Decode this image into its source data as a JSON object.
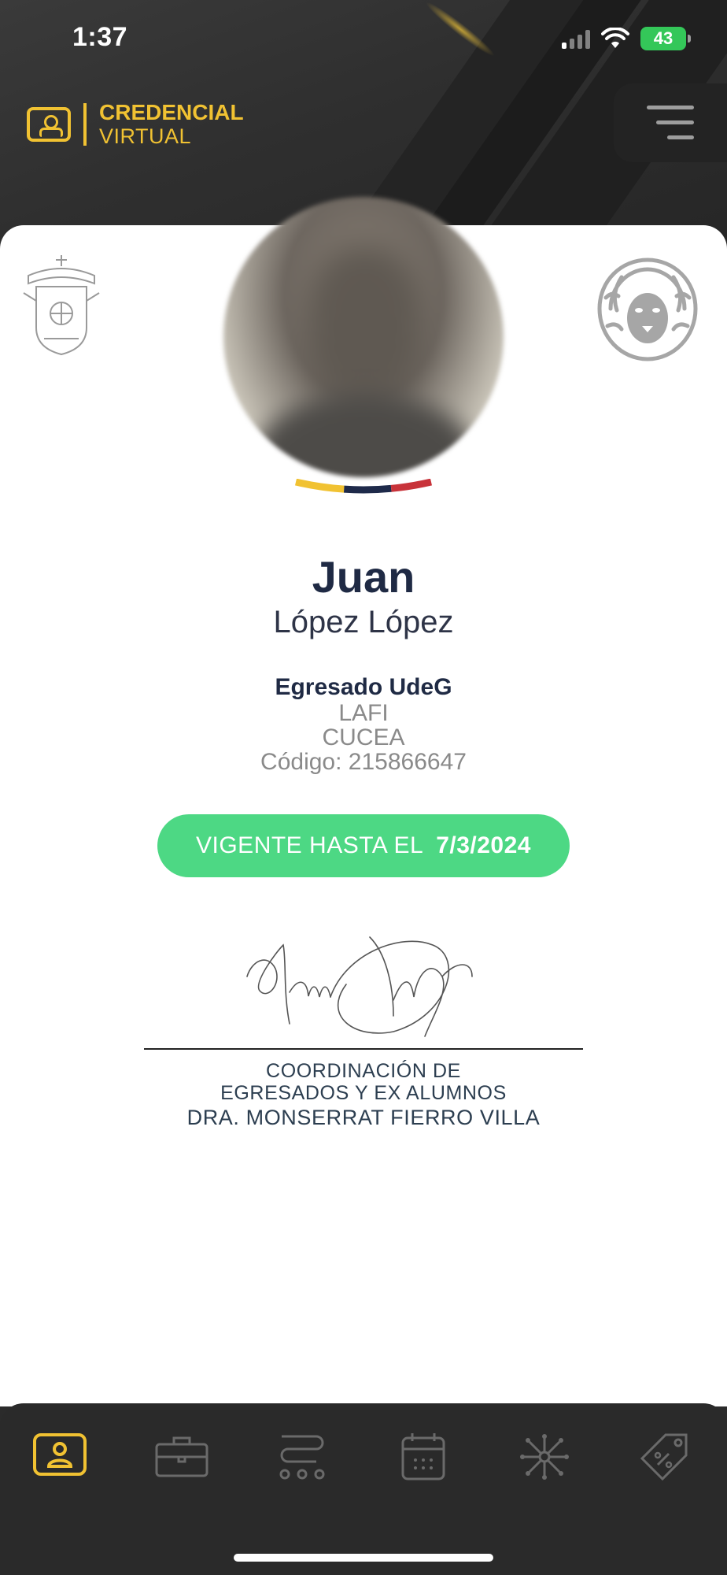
{
  "status_bar": {
    "time": "1:37",
    "battery": "43"
  },
  "brand": {
    "line1": "CREDENCIAL",
    "line2": "VIRTUAL",
    "accent_color": "#f1c232"
  },
  "card": {
    "first_name": "Juan",
    "last_name": "López López",
    "role": "Egresado UdeG",
    "program": "LAFI",
    "center": "CUCEA",
    "code": "Código: 215866647",
    "validity_label": "VIGENTE HASTA EL",
    "validity_date": "7/3/2024",
    "validity_color": "#4dd884",
    "signature_lines": [
      "COORDINACIÓN DE",
      "EGRESADOS Y EX ALUMNOS",
      "DRA. MONSERRAT FIERRO VILLA"
    ]
  },
  "nav": {
    "items": [
      {
        "icon": "id-card-icon",
        "active": true
      },
      {
        "icon": "briefcase-icon",
        "active": false
      },
      {
        "icon": "route-icon",
        "active": false
      },
      {
        "icon": "calendar-icon",
        "active": false
      },
      {
        "icon": "network-icon",
        "active": false
      },
      {
        "icon": "discount-tag-icon",
        "active": false
      }
    ],
    "active_color": "#f1c232",
    "inactive_color": "#6a6a6a"
  }
}
